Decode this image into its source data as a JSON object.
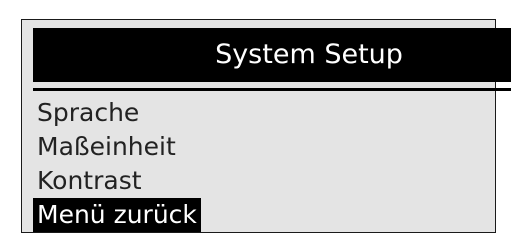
{
  "header": {
    "title": "System Setup"
  },
  "menu": {
    "items": [
      {
        "label": "Sprache",
        "selected": false
      },
      {
        "label": "Maßeinheit",
        "selected": false
      },
      {
        "label": "Kontrast",
        "selected": false
      },
      {
        "label": "Menü zurück",
        "selected": true
      }
    ]
  },
  "colors": {
    "screen_background": "#e4e4e4",
    "highlight": "#000000",
    "text": "#222222",
    "highlight_text": "#ffffff"
  }
}
